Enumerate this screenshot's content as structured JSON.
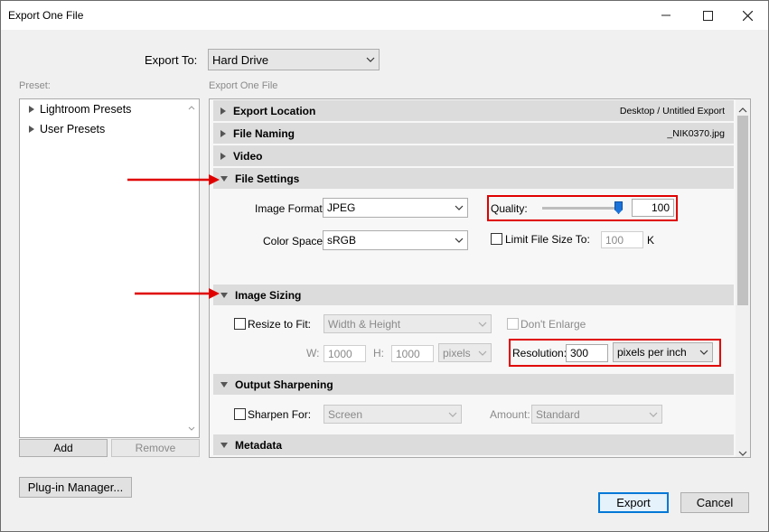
{
  "window": {
    "title": "Export One File"
  },
  "export_to": {
    "label": "Export To:",
    "value": "Hard Drive"
  },
  "preset": {
    "label": "Preset:",
    "items": [
      "Lightroom Presets",
      "User Presets"
    ],
    "add_label": "Add",
    "remove_label": "Remove"
  },
  "panel": {
    "title": "Export One File",
    "sections": {
      "export_location": {
        "label": "Export Location",
        "summary": "Desktop / Untitled Export"
      },
      "file_naming": {
        "label": "File Naming",
        "summary": "_NIK0370.jpg"
      },
      "video": {
        "label": "Video"
      },
      "file_settings": {
        "label": "File Settings",
        "image_format_label": "Image Format:",
        "image_format": "JPEG",
        "color_space_label": "Color Space:",
        "color_space": "sRGB",
        "quality_label": "Quality:",
        "quality_value": "100",
        "quality_fraction": 1.0,
        "limit_label": "Limit File Size To:",
        "limit_value": "100",
        "limit_unit": "K"
      },
      "image_sizing": {
        "label": "Image Sizing",
        "resize_label": "Resize to Fit:",
        "resize_mode": "Width & Height",
        "dont_enlarge_label": "Don't Enlarge",
        "w_label": "W:",
        "w_value": "1000",
        "h_label": "H:",
        "h_value": "1000",
        "units": "pixels",
        "resolution_label": "Resolution:",
        "resolution_value": "300",
        "resolution_units": "pixels per inch"
      },
      "output_sharpening": {
        "label": "Output Sharpening",
        "sharpen_label": "Sharpen For:",
        "sharpen_value": "Screen",
        "amount_label": "Amount:",
        "amount_value": "Standard"
      },
      "metadata": {
        "label": "Metadata"
      }
    }
  },
  "footer": {
    "plugin_manager": "Plug-in Manager...",
    "export": "Export",
    "cancel": "Cancel"
  },
  "colors": {
    "accent": "#0078d7",
    "annotation": "#e00000"
  }
}
